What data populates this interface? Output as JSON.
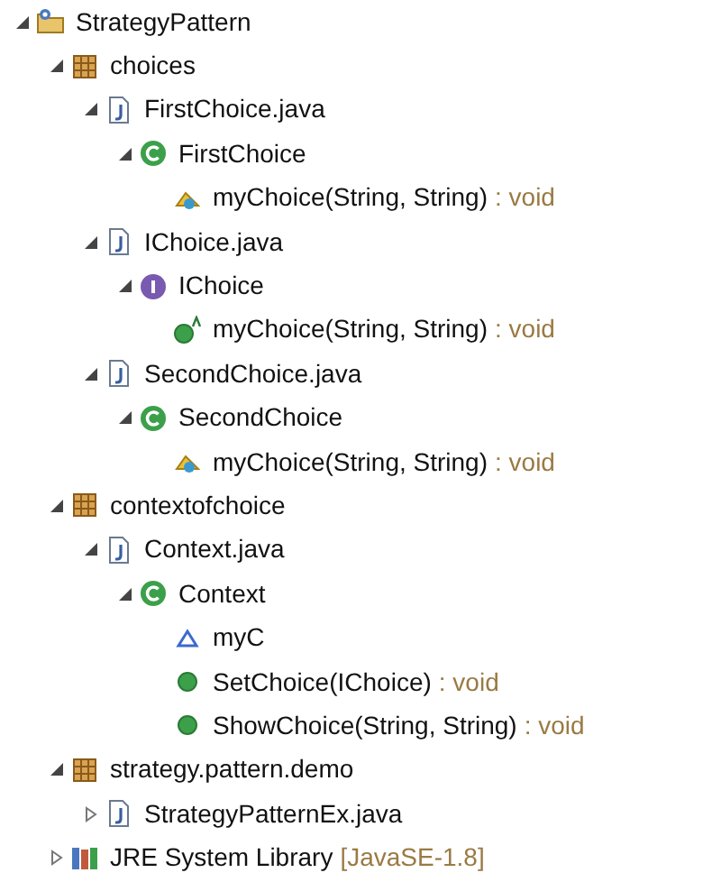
{
  "tree": [
    {
      "kind": "project",
      "label": "StrategyPattern",
      "expanded": true,
      "children": [
        {
          "kind": "package",
          "label": "choices",
          "expanded": true,
          "children": [
            {
              "kind": "java-file",
              "label": "FirstChoice.java",
              "expanded": true,
              "children": [
                {
                  "kind": "class",
                  "label": "FirstChoice",
                  "expanded": true,
                  "children": [
                    {
                      "kind": "protected-method",
                      "label": "myChoice(String, String)",
                      "suffix": ": void"
                    }
                  ]
                }
              ]
            },
            {
              "kind": "java-file",
              "label": "IChoice.java",
              "expanded": true,
              "children": [
                {
                  "kind": "interface",
                  "label": "IChoice",
                  "expanded": true,
                  "children": [
                    {
                      "kind": "abstract-method",
                      "label": "myChoice(String, String)",
                      "suffix": ": void"
                    }
                  ]
                }
              ]
            },
            {
              "kind": "java-file",
              "label": "SecondChoice.java",
              "expanded": true,
              "children": [
                {
                  "kind": "class",
                  "label": "SecondChoice",
                  "expanded": true,
                  "children": [
                    {
                      "kind": "protected-method",
                      "label": "myChoice(String, String)",
                      "suffix": ": void"
                    }
                  ]
                }
              ]
            }
          ]
        },
        {
          "kind": "package",
          "label": "contextofchoice",
          "expanded": true,
          "children": [
            {
              "kind": "java-file",
              "label": "Context.java",
              "expanded": true,
              "children": [
                {
                  "kind": "class",
                  "label": "Context",
                  "expanded": true,
                  "children": [
                    {
                      "kind": "field",
                      "label": "myC"
                    },
                    {
                      "kind": "method",
                      "label": "SetChoice(IChoice)",
                      "suffix": ": void"
                    },
                    {
                      "kind": "method",
                      "label": "ShowChoice(String, String)",
                      "suffix": ": void"
                    }
                  ]
                }
              ]
            }
          ]
        },
        {
          "kind": "package",
          "label": "strategy.pattern.demo",
          "expanded": true,
          "children": [
            {
              "kind": "java-file",
              "label": "StrategyPatternEx.java",
              "expanded": false
            }
          ]
        },
        {
          "kind": "library",
          "label": "JRE System Library",
          "suffix": "[JavaSE-1.8]",
          "expanded": false
        }
      ]
    }
  ]
}
